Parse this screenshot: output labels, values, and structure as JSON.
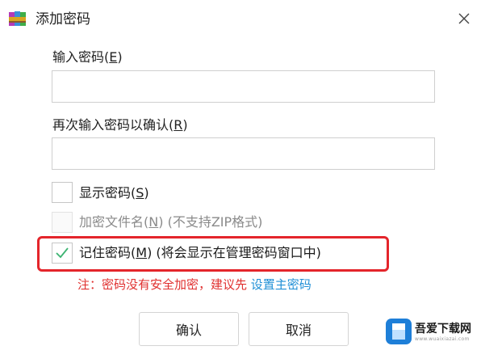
{
  "window": {
    "title": "添加密码",
    "app_icon": "winrar-books-icon",
    "close_icon": "close-icon"
  },
  "fields": {
    "password": {
      "label_text": "输入密码",
      "label_key": "E",
      "value": ""
    },
    "confirm": {
      "label_text": "再次输入密码以确认",
      "label_key": "R",
      "value": ""
    }
  },
  "options": {
    "show_password": {
      "text": "显示密码",
      "key": "S",
      "checked": false,
      "enabled": true
    },
    "encrypt_names": {
      "text": "加密文件名",
      "key": "N",
      "suffix": " (不支持ZIP格式)",
      "checked": false,
      "enabled": false
    },
    "remember": {
      "text": "记住密码",
      "key": "M",
      "suffix": " (将会显示在管理密码窗口中)",
      "checked": true,
      "enabled": true
    }
  },
  "note": {
    "text": "注：密码没有安全加密，建议先 ",
    "link": "设置主密码"
  },
  "buttons": {
    "ok": "确认",
    "cancel": "取消"
  },
  "colors": {
    "highlight": "#e4252b",
    "note": "#e0302f",
    "link": "#1f8fd6",
    "check": "#3cb371"
  },
  "watermark": {
    "title": "吾爱下载网",
    "sub": "www.wuaixiazai.com"
  }
}
